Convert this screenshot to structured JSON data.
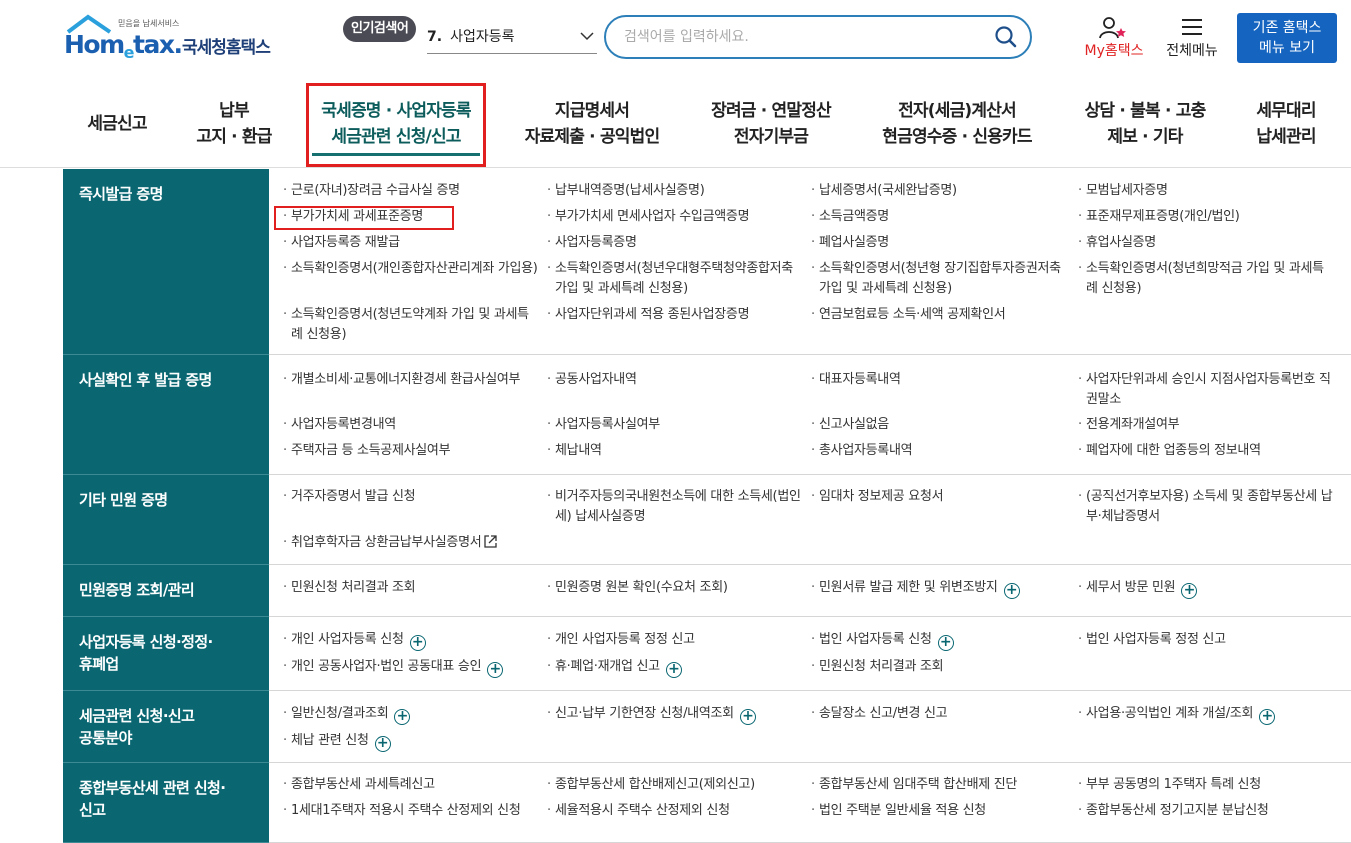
{
  "header": {
    "logo_tagline": "믿음을 납세서비스",
    "logo_wordmark_a": "Hom",
    "logo_wordmark_e": "e",
    "logo_wordmark_b": "tax.",
    "logo_kor": "국세청홈택스",
    "popular_badge": "인기검색어",
    "popular_rank": "7.",
    "popular_term": "사업자등록",
    "search_placeholder": "검색어를 입력하세요.",
    "my_hometax": "My홈택스",
    "all_menu": "전체메뉴",
    "old_menu_line1": "기존 홈택스",
    "old_menu_line2": "메뉴 보기"
  },
  "gnb": [
    {
      "line1": "세금신고",
      "line2": ""
    },
    {
      "line1": "납부",
      "line2": "고지 · 환급"
    },
    {
      "line1": "국세증명 · 사업자등록",
      "line2": "세금관련 신청/신고"
    },
    {
      "line1": "지급명세서",
      "line2": "자료제출 · 공익법인"
    },
    {
      "line1": "장려금 · 연말정산",
      "line2": "전자기부금"
    },
    {
      "line1": "전자(세금)계산서",
      "line2": "현금영수증 · 신용카드"
    },
    {
      "line1": "상담 · 불복 · 고충",
      "line2": "제보 · 기타"
    },
    {
      "line1": "세무대리",
      "line2": "납세관리"
    }
  ],
  "sections": [
    {
      "title": "즉시발급 증명",
      "links": [
        [
          "근로(자녀)장려금 수급사실 증명",
          "납부내역증명(납세사실증명)",
          "납세증명서(국세완납증명)",
          "모범납세자증명"
        ],
        [
          "부가가치세 과세표준증명",
          "부가가치세 면세사업자 수입금액증명",
          "소득금액증명",
          "표준재무제표증명(개인/법인)"
        ],
        [
          "사업자등록증 재발급",
          "사업자등록증명",
          "폐업사실증명",
          "휴업사실증명"
        ],
        [
          "소득확인증명서(개인종합자산관리계좌 가입용)",
          "소득확인증명서(청년우대형주택청약종합저축 가입 및 과세특례 신청용)",
          "소득확인증명서(청년형 장기집합투자증권저축 가입 및 과세특례 신청용)",
          "소득확인증명서(청년희망적금 가입 및 과세특례 신청용)"
        ],
        [
          "소득확인증명서(청년도약계좌 가입 및 과세특례 신청용)",
          "사업자단위과세 적용 종된사업장증명",
          "연금보험료등 소득·세액 공제확인서",
          ""
        ]
      ]
    },
    {
      "title": "사실확인 후 발급 증명",
      "links": [
        [
          "개별소비세·교통에너지환경세 환급사실여부",
          "공동사업자내역",
          "대표자등록내역",
          "사업자단위과세 승인시 지점사업자등록번호 직권말소"
        ],
        [
          "사업자등록변경내역",
          "사업자등록사실여부",
          "신고사실없음",
          "전용계좌개설여부"
        ],
        [
          "주택자금 등 소득공제사실여부",
          "체납내역",
          "총사업자등록내역",
          "폐업자에 대한 업종등의 정보내역"
        ]
      ]
    },
    {
      "title": "기타 민원 증명",
      "links": [
        [
          "거주자증명서 발급 신청",
          "비거주자등의국내원천소득에 대한 소득세(법인세) 납세사실증명",
          "임대차 정보제공 요청서",
          "(공직선거후보자용) 소득세 및 종합부동산세 납부·체납증명서"
        ],
        [
          "취업후학자금 상환금납부사실증명서",
          "",
          "",
          ""
        ]
      ]
    },
    {
      "title": "민원증명 조회/관리",
      "links": [
        [
          "민원신청 처리결과 조회",
          "민원증명 원본 확인(수요처 조회)",
          "민원서류 발급 제한 및 위변조방지",
          "세무서 방문 민원"
        ]
      ]
    },
    {
      "title_line1": "사업자등록 신청·정정·",
      "title_line2": "휴폐업",
      "links": [
        [
          "개인 사업자등록 신청",
          "개인 사업자등록 정정 신고",
          "법인 사업자등록 신청",
          "법인 사업자등록 정정 신고"
        ],
        [
          "개인 공동사업자·법인 공동대표 승인",
          "휴·폐업·재개업 신고",
          "민원신청 처리결과 조회",
          ""
        ]
      ]
    },
    {
      "title_line1": "세금관련 신청·신고",
      "title_line2": "공통분야",
      "links": [
        [
          "일반신청/결과조회",
          "신고·납부 기한연장 신청/내역조회",
          "송달장소 신고/변경 신고",
          "사업용·공익법인 계좌 개설/조회"
        ],
        [
          "체납 관련 신청",
          "",
          "",
          ""
        ]
      ]
    },
    {
      "title_line1": "종합부동산세 관련 신청·",
      "title_line2": "신고",
      "links": [
        [
          "종합부동산세 과세특례신고",
          "종합부동산세 합산배제신고(제외신고)",
          "종합부동산세 임대주택 합산배제 진단",
          "부부 공동명의 1주택자 특례 신청"
        ],
        [
          "1세대1주택자 적용시 주택수 산정제외 신청",
          "세율적용시 주택수 산정제외 신청",
          "법인 주택분 일반세율 적용 신청",
          "종합부동산세 정기고지분 분납신청"
        ]
      ]
    }
  ]
}
